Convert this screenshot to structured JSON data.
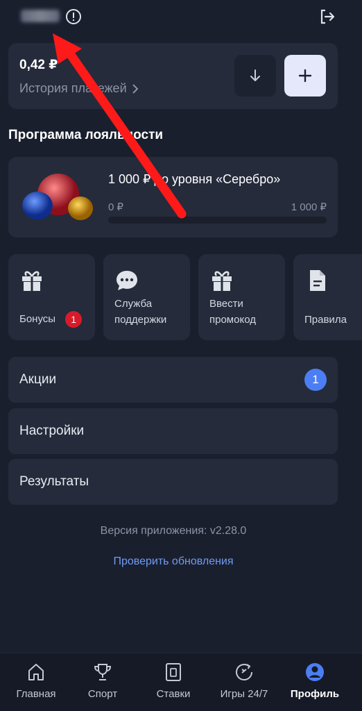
{
  "header": {
    "username_blurred": ""
  },
  "balance": {
    "amount": "0,42 ₽",
    "history_label": "История платежей"
  },
  "loyalty": {
    "title": "Программа лояльности",
    "level_text": "1 000 ₽ до уровня «Серебро»",
    "min_label": "0 ₽",
    "max_label": "1 000 ₽",
    "progress": 0
  },
  "tiles": [
    {
      "label": "Бонусы",
      "badge": "1",
      "icon": "gift-icon"
    },
    {
      "label_line1": "Служба",
      "label_line2": "поддержки",
      "icon": "chat-icon"
    },
    {
      "label_line1": "Ввести",
      "label_line2": "промокод",
      "icon": "gift-icon"
    },
    {
      "label": "Правила",
      "icon": "document-icon"
    }
  ],
  "menu": [
    {
      "label": "Акции",
      "badge": "1"
    },
    {
      "label": "Настройки"
    },
    {
      "label": "Результаты"
    }
  ],
  "version_text": "Версия приложения: v2.28.0",
  "check_updates": "Проверить обновления",
  "tabbar": [
    {
      "label": "Главная",
      "icon": "home-icon"
    },
    {
      "label": "Спорт",
      "icon": "trophy-icon"
    },
    {
      "label": "Ставки",
      "icon": "ticket-icon"
    },
    {
      "label": "Игры 24/7",
      "icon": "games-icon"
    },
    {
      "label": "Профиль",
      "icon": "profile-icon",
      "active": true
    }
  ],
  "colors": {
    "background": "#1a1f2e",
    "card": "#252b3b",
    "accent": "#4c7ef3",
    "badge_red": "#d81b2a",
    "annotation_arrow": "#ff1a1a"
  }
}
